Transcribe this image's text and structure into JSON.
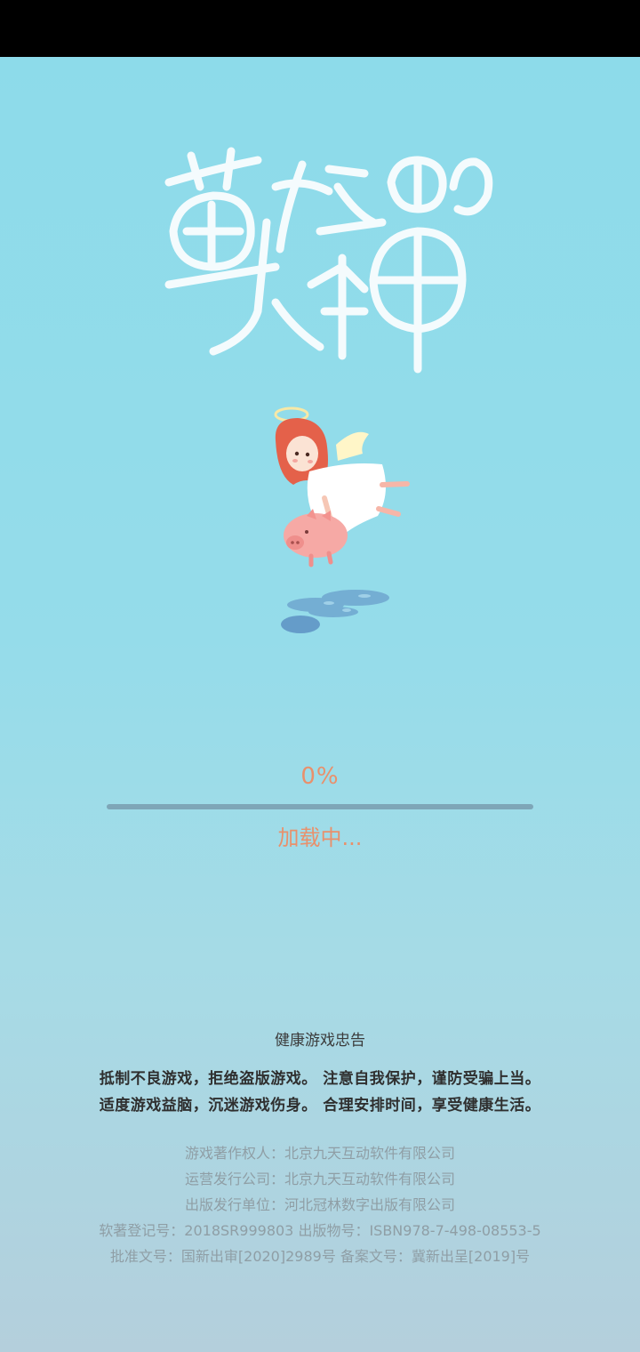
{
  "loading": {
    "progress_percent": 0,
    "percent_label": "0%",
    "status_text": "加载中..."
  },
  "notice": {
    "title": "健康游戏忠告",
    "line1": "抵制不良游戏，拒绝盗版游戏。  注意自我保护，谨防受骗上当。",
    "line2": "适度游戏益脑，沉迷游戏伤身。  合理安排时间，享受健康生活。"
  },
  "copyright": {
    "line1": "游戏著作权人：北京九天互动软件有限公司",
    "line2": "运营发行公司：北京九天互动软件有限公司",
    "line3": "出版发行单位：河北冠林数字出版有限公司",
    "line4": "软著登记号：2018SR999803  出版物号：ISBN978-7-498-08553-5",
    "line5": "批准文号：国新出审[2020]2989号   备案文号：冀新出呈[2019]号"
  },
  "colors": {
    "accent": "#e9906b",
    "background_top": "#8ddbea",
    "background_bottom": "#b4cfdc"
  },
  "icons": {
    "logo": "game-logo-brush-lettering",
    "mascot": "angel-girl-riding-pig-icon"
  }
}
